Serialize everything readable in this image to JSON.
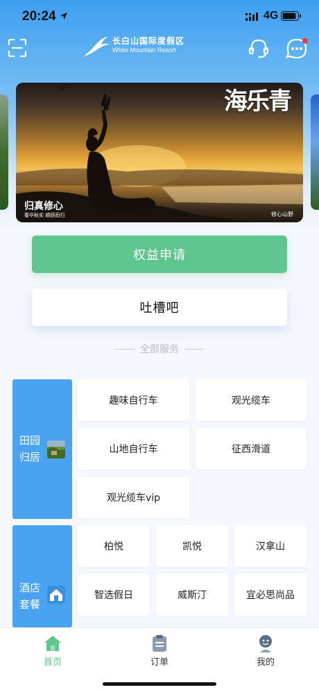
{
  "status_bar": {
    "time": "20:24",
    "network": "4G"
  },
  "header": {
    "logo_cn": "长白山国际度假区",
    "logo_en": "White Mountain Resort"
  },
  "banner": {
    "title_big": "海乐青",
    "tagline": "归真修心",
    "sub": "春华秋实  顺颐而归",
    "corner": "修心山野"
  },
  "actions": {
    "benefit_label": "权益申请",
    "feedback_label": "吐槽吧"
  },
  "section_title": "全部服务",
  "groups": [
    {
      "label": "田园归居",
      "items": [
        "趣味自行车",
        "观光缆车",
        "山地自行车",
        "征西滑道",
        "观光缆车vip"
      ]
    },
    {
      "label": "酒店套餐",
      "items": [
        "柏悦",
        "凯悦",
        "汉拿山",
        "智选假日",
        "威斯汀",
        "宜必思尚品"
      ]
    }
  ],
  "tab_bar": {
    "items": [
      {
        "label": "首页",
        "icon": "home-icon",
        "active": true
      },
      {
        "label": "订单",
        "icon": "order-icon",
        "active": false
      },
      {
        "label": "我的",
        "icon": "profile-icon",
        "active": false
      }
    ]
  },
  "colors": {
    "accent_green": "#5ec58f",
    "accent_blue": "#4aa3f2",
    "badge_red": "#f03a3a"
  }
}
